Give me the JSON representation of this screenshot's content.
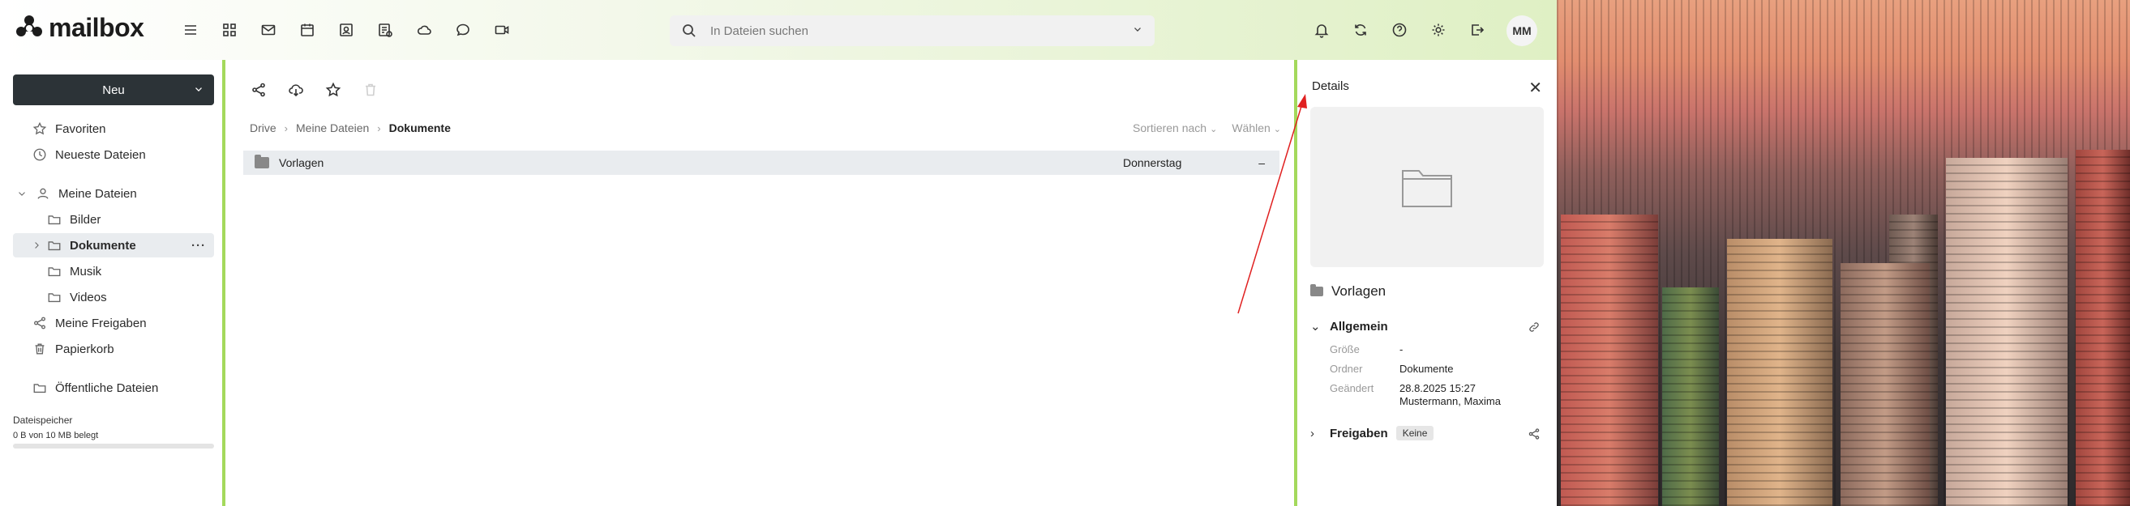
{
  "header": {
    "logo_text": "mailbox",
    "search": {
      "placeholder": "In Dateien suchen"
    },
    "avatar_initials": "MM",
    "app_icons": [
      "menu-icon",
      "apps-grid-icon",
      "mail-icon",
      "calendar-icon",
      "contacts-icon",
      "tasks-icon",
      "cloud-icon",
      "chat-icon",
      "video-icon"
    ],
    "right_icons": [
      "bell-icon",
      "sync-icon",
      "help-icon",
      "gear-icon",
      "logout-icon"
    ]
  },
  "sidebar": {
    "new_button": "Neu",
    "items": [
      {
        "label": "Favoriten",
        "icon": "star-icon"
      },
      {
        "label": "Neueste Dateien",
        "icon": "clock-icon"
      },
      {
        "label": "Meine Dateien",
        "icon": "user-icon"
      },
      {
        "label": "Bilder",
        "icon": "folder-icon"
      },
      {
        "label": "Dokumente",
        "icon": "folder-icon"
      },
      {
        "label": "Musik",
        "icon": "folder-icon"
      },
      {
        "label": "Videos",
        "icon": "folder-icon"
      },
      {
        "label": "Meine Freigaben",
        "icon": "share-icon"
      },
      {
        "label": "Papierkorb",
        "icon": "trash-icon"
      },
      {
        "label": "Öffentliche Dateien",
        "icon": "folder-icon"
      }
    ],
    "active_more": "···",
    "storage": {
      "label": "Dateispeicher",
      "used": "0 B von 10 MB belegt",
      "fraction": 0.0
    }
  },
  "main": {
    "breadcrumb": [
      "Drive",
      "Meine Dateien",
      "Dokumente"
    ],
    "sort_label": "Sortieren nach",
    "select_label": "Wählen",
    "files": [
      {
        "name": "Vorlagen",
        "date": "Donnerstag",
        "size": "–"
      }
    ]
  },
  "details": {
    "title": "Details",
    "name": "Vorlagen",
    "general": {
      "title": "Allgemein",
      "size_label": "Größe",
      "size_value": "-",
      "folder_label": "Ordner",
      "folder_value": "Dokumente",
      "modified_label": "Geändert",
      "modified_date": "28.8.2025 15:27",
      "modified_by": "Mustermann, Maxima"
    },
    "shares": {
      "title": "Freigaben",
      "badge": "Keine"
    }
  },
  "colors": {
    "accent": "#a4d95c",
    "button_dark": "#2c3337",
    "arrow": "#e02020"
  }
}
